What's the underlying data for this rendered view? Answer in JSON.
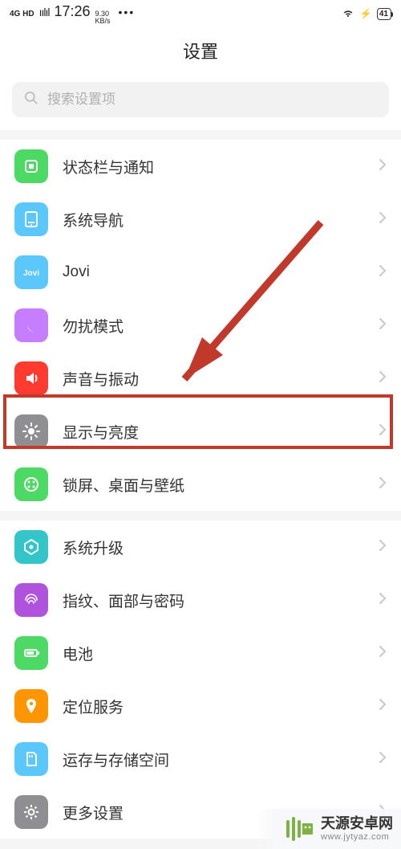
{
  "status_bar": {
    "network_label": "4G HD",
    "signal_glyph": "ıılıl",
    "time": "17:26",
    "data_rate_value": "9.30",
    "data_rate_unit": "KB/s",
    "more_glyph": "•••",
    "battery_pct": "41"
  },
  "header": {
    "title": "设置"
  },
  "search": {
    "placeholder": "搜索设置项"
  },
  "groups": [
    {
      "items": [
        {
          "key": "status_notify",
          "label": "状态栏与通知",
          "icon": "status"
        },
        {
          "key": "system_nav",
          "label": "系统导航",
          "icon": "nav"
        },
        {
          "key": "jovi",
          "label": "Jovi",
          "icon": "jovi"
        },
        {
          "key": "dnd",
          "label": "勿扰模式",
          "icon": "dnd"
        },
        {
          "key": "sound",
          "label": "声音与振动",
          "icon": "sound"
        },
        {
          "key": "display",
          "label": "显示与亮度",
          "icon": "disp"
        },
        {
          "key": "lock_wall",
          "label": "锁屏、桌面与壁纸",
          "icon": "lock"
        }
      ]
    },
    {
      "items": [
        {
          "key": "sys_update",
          "label": "系统升级",
          "icon": "update"
        },
        {
          "key": "finger_face",
          "label": "指纹、面部与密码",
          "icon": "finger"
        },
        {
          "key": "battery",
          "label": "电池",
          "icon": "batt"
        },
        {
          "key": "location",
          "label": "定位服务",
          "icon": "loc"
        },
        {
          "key": "storage",
          "label": "运存与存储空间",
          "icon": "store"
        },
        {
          "key": "more",
          "label": "更多设置",
          "icon": "more"
        }
      ]
    }
  ],
  "annotation": {
    "highlight_item_key": "display",
    "arrow_color": "#c0392b"
  },
  "watermark": {
    "brand": "天源安卓网",
    "domain": "www.jytyaz.com"
  }
}
